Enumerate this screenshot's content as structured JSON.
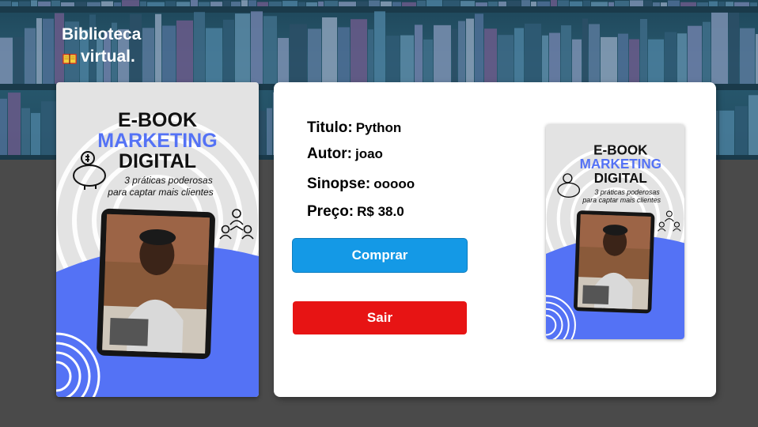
{
  "brand": {
    "line1": "Biblioteca",
    "line2": "virtual.",
    "icon": "book-icon"
  },
  "ebook": {
    "title_line1": "E-BOOK",
    "title_line2": "MARKETING",
    "title_line3": "DIGITAL",
    "subtitle_line1": "3 práticas poderosas",
    "subtitle_line2": "para captar mais clientes",
    "accent_color": "#5472f5"
  },
  "details": {
    "titulo_label": "Titulo:",
    "titulo_value": "Python",
    "autor_label": "Autor:",
    "autor_value": "joao",
    "sinopse_label": "Sinopse:",
    "sinopse_value": "ooooo",
    "preco_label": "Preço:",
    "preco_value": "R$ 38.0"
  },
  "actions": {
    "buy_label": "Comprar",
    "exit_label": "Sair",
    "buy_color": "#1499e6",
    "exit_color": "#e71414"
  }
}
